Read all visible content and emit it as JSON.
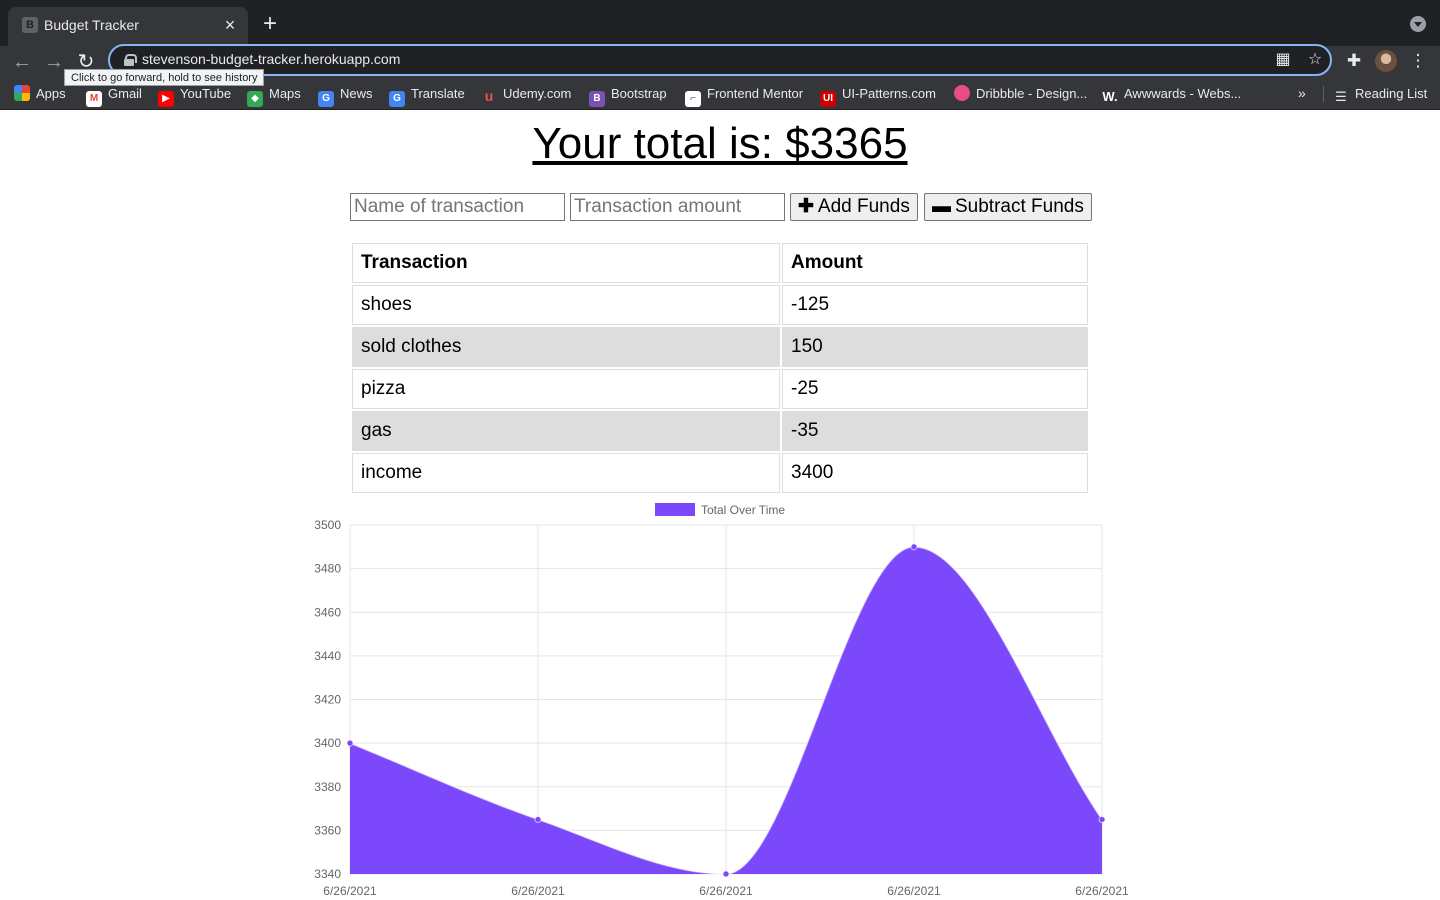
{
  "browser": {
    "tab_title": "Budget Tracker",
    "url": "stevenson-budget-tracker.herokuapp.com",
    "tooltip": "Click to go forward, hold to see history",
    "bookmarks": [
      {
        "label": "Apps",
        "icon": "apps-grid-icon",
        "color": "#4285f4"
      },
      {
        "label": "Gmail",
        "icon": "gmail-icon",
        "color": "#ea4335"
      },
      {
        "label": "YouTube",
        "icon": "youtube-icon",
        "color": "#ff0000"
      },
      {
        "label": "Maps",
        "icon": "maps-icon",
        "color": "#34a853"
      },
      {
        "label": "News",
        "icon": "news-icon",
        "color": "#4285f4"
      },
      {
        "label": "Translate",
        "icon": "translate-icon",
        "color": "#4285f4"
      },
      {
        "label": "Udemy.com",
        "icon": "udemy-icon",
        "color": "#ec5252"
      },
      {
        "label": "Bootstrap",
        "icon": "bootstrap-icon",
        "color": "#7952b3"
      },
      {
        "label": "Frontend Mentor",
        "icon": "frontend-mentor-icon",
        "color": "#e8eaed"
      },
      {
        "label": "UI-Patterns.com",
        "icon": "ui-patterns-icon",
        "color": "#cc0000"
      },
      {
        "label": "Dribbble - Design...",
        "icon": "dribbble-icon",
        "color": "#ea4c89"
      },
      {
        "label": "Awwwards - Webs...",
        "icon": "awwwards-icon",
        "color": "#35363a"
      }
    ],
    "reading_list": "Reading List"
  },
  "page": {
    "total_text": "Your total is: $3365",
    "name_placeholder": "Name of transaction",
    "amount_placeholder": "Transaction amount",
    "add_label": "Add Funds",
    "subtract_label": "Subtract Funds",
    "table": {
      "headers": [
        "Transaction",
        "Amount"
      ],
      "rows": [
        {
          "name": "shoes",
          "amount": "-125"
        },
        {
          "name": "sold clothes",
          "amount": "150"
        },
        {
          "name": "pizza",
          "amount": "-25"
        },
        {
          "name": "gas",
          "amount": "-35"
        },
        {
          "name": "income",
          "amount": "3400"
        }
      ]
    }
  },
  "chart_data": {
    "type": "area",
    "title": "",
    "legend": "top",
    "grid": true,
    "color": "#7b48fb",
    "x": [
      "6/26/2021",
      "6/26/2021",
      "6/26/2021",
      "6/26/2021",
      "6/26/2021"
    ],
    "series": [
      {
        "name": "Total Over Time",
        "values": [
          3400,
          3365,
          3340,
          3490,
          3365
        ]
      }
    ],
    "ylim": [
      3340,
      3500
    ],
    "yticks": [
      3340,
      3360,
      3380,
      3400,
      3420,
      3440,
      3460,
      3480,
      3500
    ]
  }
}
